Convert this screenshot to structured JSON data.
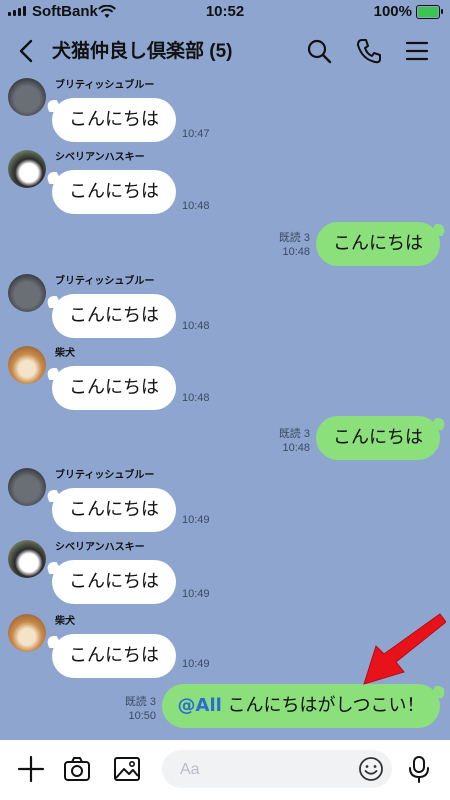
{
  "status": {
    "carrier": "SoftBank",
    "time": "10:52",
    "battery": "100%"
  },
  "header": {
    "title": "犬猫仲良し倶楽部 (5)"
  },
  "messages": [
    {
      "sender": "ブリティッシュブルー",
      "text": "こんにちは",
      "time": "10:47",
      "avatar": "gray-cat"
    },
    {
      "sender": "シベリアンハスキー",
      "text": "こんにちは",
      "time": "10:48",
      "avatar": "husky"
    },
    {
      "read": "既読 3",
      "text": "こんにちは",
      "time": "10:48"
    },
    {
      "sender": "ブリティッシュブルー",
      "text": "こんにちは",
      "time": "10:48",
      "avatar": "gray-cat"
    },
    {
      "sender": "柴犬",
      "text": "こんにちは",
      "time": "10:48",
      "avatar": "shiba"
    },
    {
      "read": "既読 3",
      "text": "こんにちは",
      "time": "10:48"
    },
    {
      "sender": "ブリティッシュブルー",
      "text": "こんにちは",
      "time": "10:49",
      "avatar": "gray-cat"
    },
    {
      "sender": "シベリアンハスキー",
      "text": "こんにちは",
      "time": "10:49",
      "avatar": "husky"
    },
    {
      "sender": "柴犬",
      "text": "こんにちは",
      "time": "10:49",
      "avatar": "shiba"
    },
    {
      "read": "既読 3",
      "mention": "@All",
      "text": "こんにちはがしつこい！",
      "time": "10:50"
    }
  ],
  "composer": {
    "placeholder": "Aa"
  },
  "colors": {
    "background": "#8ea6cf",
    "outgoing": "#8ce07c",
    "incoming": "#ffffff",
    "mention": "#2e6bd8",
    "arrow": "#e8121b"
  }
}
